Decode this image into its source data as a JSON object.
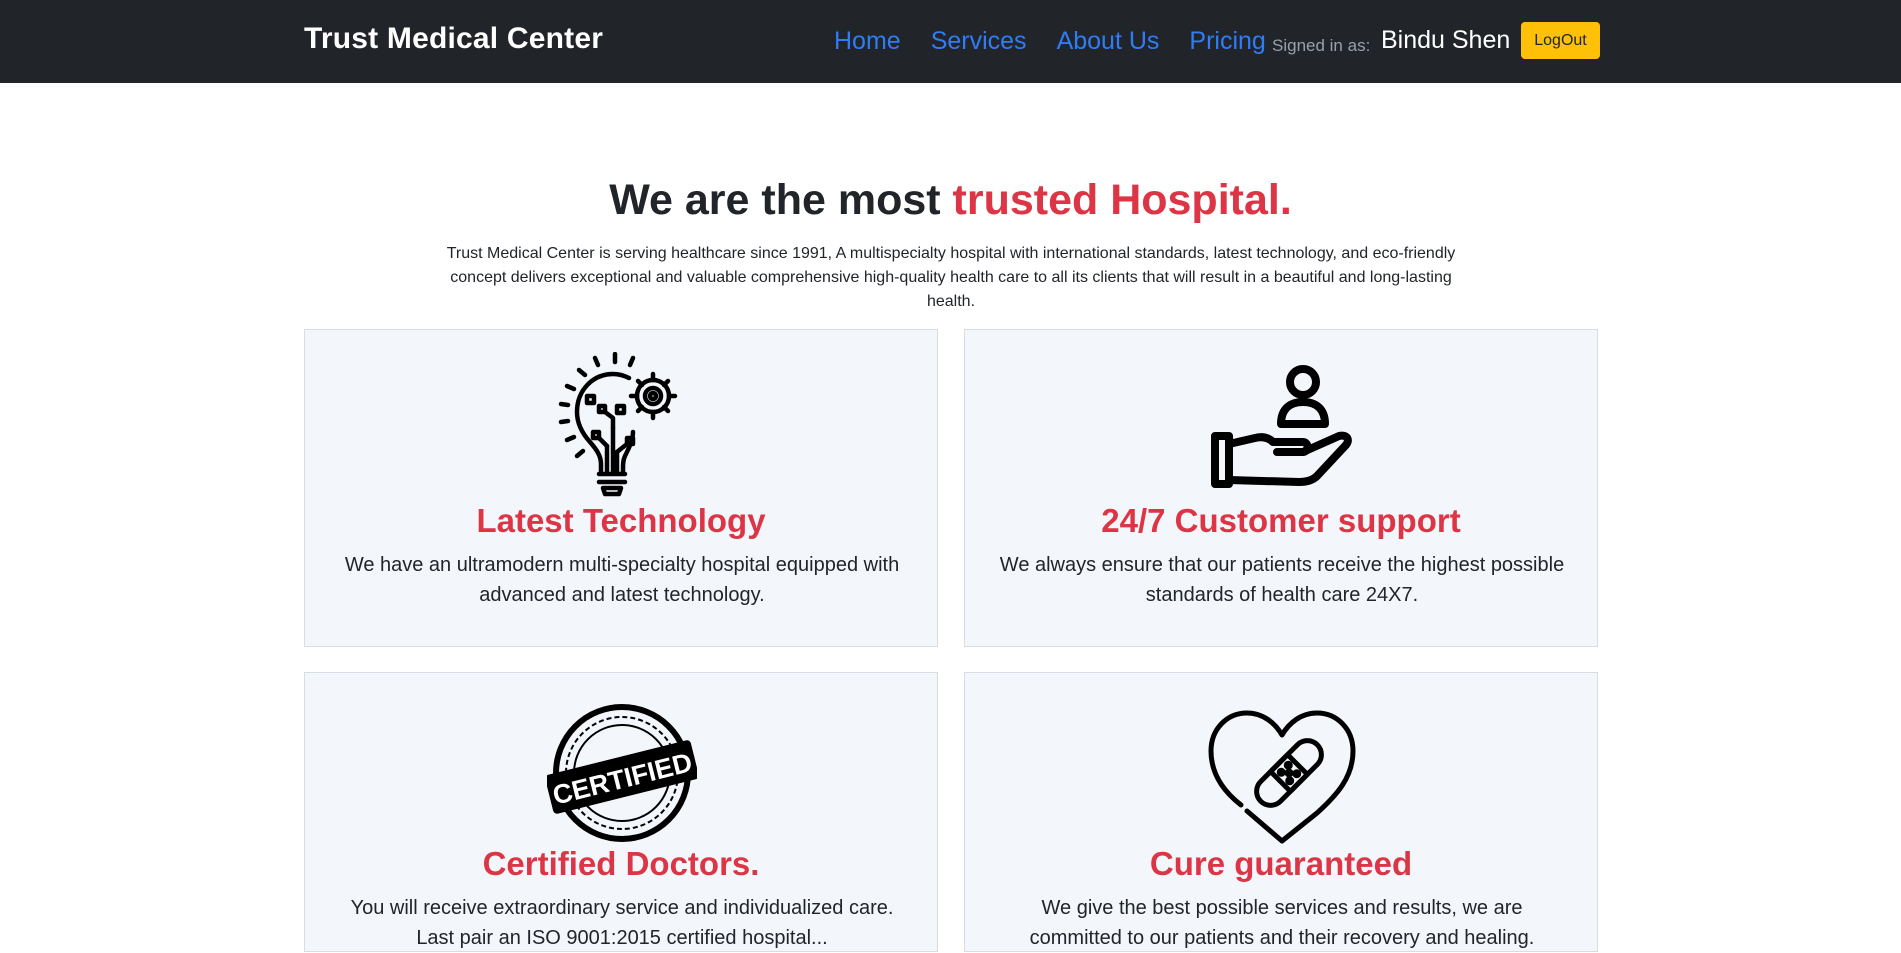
{
  "navbar": {
    "brand": "Trust Medical Center",
    "links": [
      "Home",
      "Services",
      "About Us",
      "Pricing"
    ],
    "signed_in_label": "Signed in as:",
    "user_name": "Bindu Shen",
    "logout_label": "LogOut"
  },
  "hero": {
    "title_main": "We are the most ",
    "title_accent": "trusted Hospital.",
    "text": "Trust Medical Center is serving healthcare since 1991, A multispecialty hospital with international standards, latest technology, and eco-friendly concept delivers exceptional and valuable comprehensive high-quality health care to all its clients that will result in a beautiful and long-lasting health."
  },
  "features": [
    {
      "icon": "lightbulb-gear-icon",
      "title": "Latest Technology",
      "text": "We have an ultramodern multi-specialty hospital equipped with advanced and latest technology."
    },
    {
      "icon": "hand-person-icon",
      "title": "24/7 Customer support",
      "text": "We always ensure that our patients receive the highest possible standards of health care 24X7."
    },
    {
      "icon": "certified-stamp-icon",
      "title": "Certified Doctors.",
      "text": "You will receive extraordinary service and individualized care. Last pair an ISO 9001:2015 certified hospital..."
    },
    {
      "icon": "heart-bandage-icon",
      "title": "Cure guaranteed",
      "text": "We give the best possible services and results, we are committed to our patients and their recovery and healing."
    }
  ],
  "colors": {
    "navbar_bg": "#212529",
    "link": "#2f7cf6",
    "accent": "#dc3545",
    "button": "#ffc107",
    "card_bg": "#f3f7fc"
  }
}
